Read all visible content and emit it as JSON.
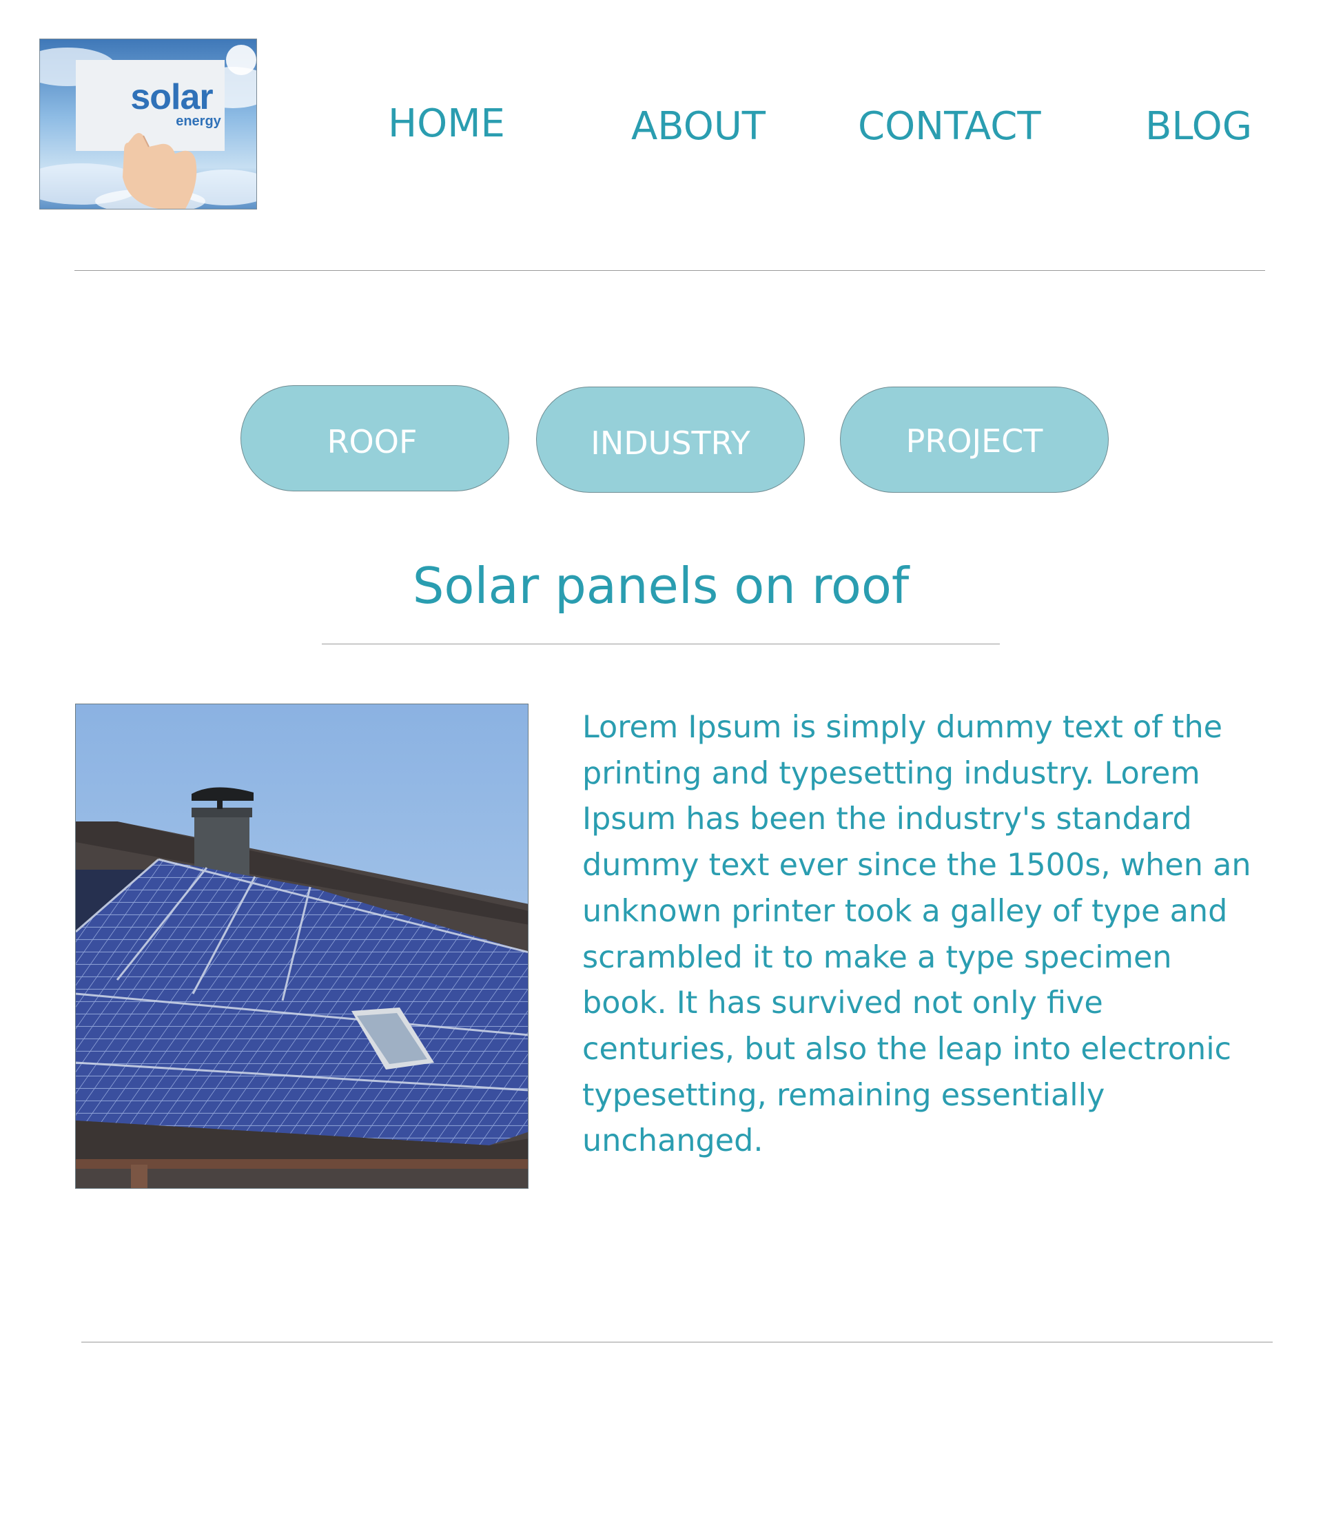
{
  "logo": {
    "word1": "solar",
    "word2": "energy"
  },
  "nav": {
    "home": "HOME",
    "about": "ABOUT",
    "contact": "CONTACT",
    "blog": "BLOG"
  },
  "categories": {
    "roof": "ROOF",
    "industry": "INDUSTRY",
    "project": "PROJECT"
  },
  "section": {
    "title": "Solar panels on roof",
    "body": "Lorem Ipsum is simply dummy text of the printing and typesetting industry. Lorem Ipsum has been the industry's standard dummy text ever since the 1500s, when an unknown printer took a galley of type and scrambled it to make a type specimen book. It has survived not only five centuries, but also the leap into electronic typesetting, remaining essentially unchanged."
  },
  "colors": {
    "accent_text": "#2a9db0",
    "pill_fill": "#96d0d9",
    "pill_text": "#ffffff",
    "divider": "#9a9a9a"
  }
}
